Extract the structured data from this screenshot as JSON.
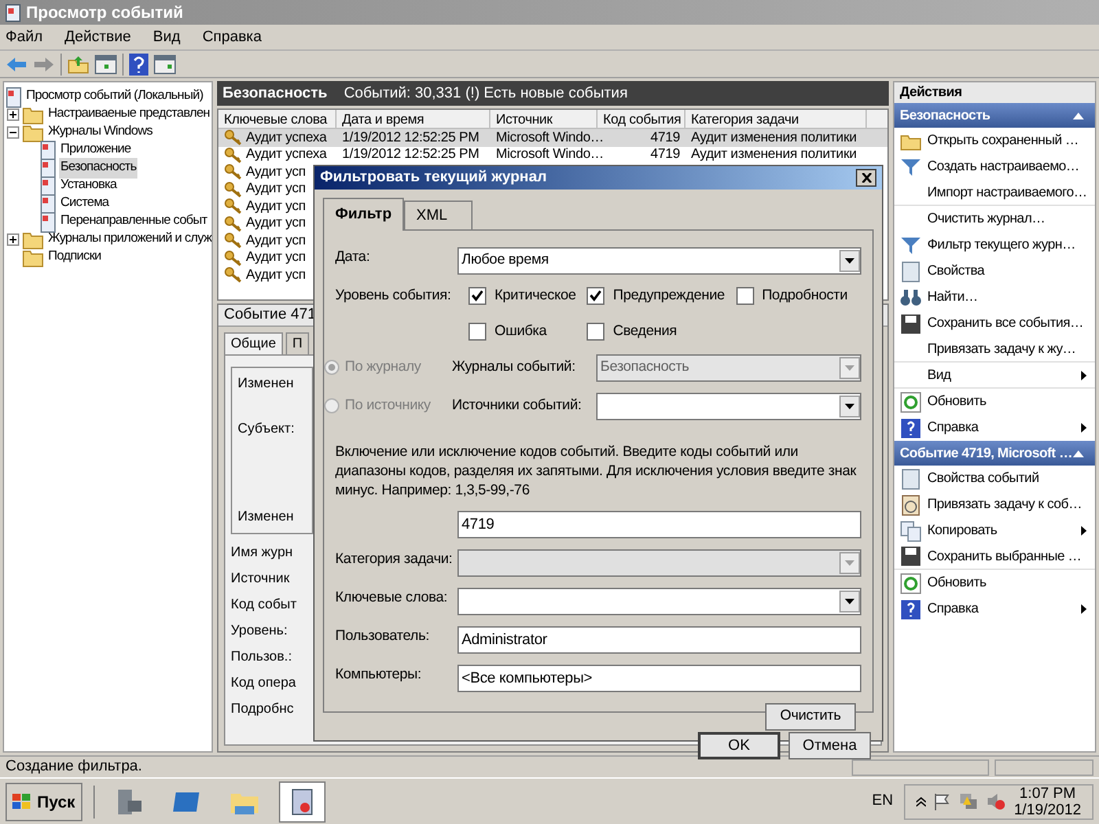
{
  "window": {
    "title": "Просмотр событий"
  },
  "menu": [
    "Файл",
    "Действие",
    "Вид",
    "Справка"
  ],
  "tree": [
    {
      "label": "Просмотр событий (Локальный)",
      "selected": false,
      "children": [
        {
          "label": "Настраиваеные представлен",
          "expanded": false,
          "selected": false
        },
        {
          "label": "Журналы Windows",
          "expanded": true,
          "selected": false,
          "children": [
            {
              "label": "Приложение",
              "selected": false
            },
            {
              "label": "Безопасность",
              "selected": true
            },
            {
              "label": "Установка",
              "selected": false
            },
            {
              "label": "Система",
              "selected": false
            },
            {
              "label": "Перенаправленные событ",
              "selected": false
            }
          ]
        },
        {
          "label": "Журналы приложений и служ",
          "expanded": false,
          "selected": false
        },
        {
          "label": "Подписки",
          "selected": false
        }
      ]
    }
  ],
  "log_header": {
    "title": "Безопасность",
    "info": "Событий: 30,331 (!) Есть новые события"
  },
  "table": {
    "columns": [
      "Ключевые слова",
      "Дата и время",
      "Источник",
      "Код события",
      "Категория задачи"
    ],
    "rows": [
      {
        "keywords": "Аудит успеха",
        "date": "1/19/2012 12:52:25 PM",
        "source": "Microsoft Windo…",
        "code": "4719",
        "category": "Аудит изменения политики",
        "selected": true
      },
      {
        "keywords": "Аудит успеха",
        "date": "1/19/2012 12:52:25 PM",
        "source": "Microsoft Windo…",
        "code": "4719",
        "category": "Аудит изменения политики",
        "selected": false
      },
      {
        "keywords": "Аудит усп",
        "selected": false
      },
      {
        "keywords": "Аудит усп",
        "selected": false
      },
      {
        "keywords": "Аудит усп",
        "selected": false
      },
      {
        "keywords": "Аудит усп",
        "selected": false
      },
      {
        "keywords": "Аудит усп",
        "selected": false
      },
      {
        "keywords": "Аудит усп",
        "selected": false
      },
      {
        "keywords": "Аудит усп",
        "selected": false
      }
    ]
  },
  "event_panel": {
    "title": "Событие 471",
    "tabs": [
      {
        "label": "Общие",
        "selected": true
      },
      {
        "label": "П",
        "selected": false
      }
    ],
    "box_lines": [
      "Изменен",
      "Субъект:",
      "Изменен"
    ],
    "fields": [
      "Имя журн",
      "Источник",
      "Код событ",
      "Уровень:",
      "Пользов.:",
      "Код опера",
      "Подробнс"
    ]
  },
  "actions": {
    "title": "Действия",
    "sections": [
      {
        "title": "Безопасность",
        "items": [
          {
            "label": "Открыть сохраненный …",
            "submenu": false
          },
          {
            "label": "Создать настраиваемо…",
            "submenu": false
          },
          {
            "label": "Импорт настраиваемого…",
            "submenu": false
          },
          {
            "label": "Очистить журнал…",
            "submenu": false
          },
          {
            "label": "Фильтр текущего журн…",
            "submenu": false
          },
          {
            "label": "Свойства",
            "submenu": false
          },
          {
            "label": "Найти…",
            "submenu": false
          },
          {
            "label": "Сохранить все события…",
            "submenu": false
          },
          {
            "label": "Привязать задачу к жу…",
            "submenu": false
          },
          {
            "label": "Вид",
            "submenu": true
          },
          {
            "label": "Обновить",
            "submenu": false
          },
          {
            "label": "Справка",
            "submenu": true
          }
        ]
      },
      {
        "title": "Событие 4719, Microsoft …",
        "items": [
          {
            "label": "Свойства событий",
            "submenu": false
          },
          {
            "label": "Привязать задачу к соб…",
            "submenu": false
          },
          {
            "label": "Копировать",
            "submenu": true
          },
          {
            "label": "Сохранить выбранные …",
            "submenu": false
          },
          {
            "label": "Обновить",
            "submenu": false
          },
          {
            "label": "Справка",
            "submenu": true
          }
        ]
      }
    ]
  },
  "status_bar": "Создание фильтра.",
  "dialog": {
    "title": "Фильтровать текущий журнал",
    "tabs": [
      {
        "label": "Фильтр",
        "selected": true
      },
      {
        "label": "XML",
        "selected": false
      }
    ],
    "date_label": "Дата:",
    "date_value": "Любое время",
    "level_label": "Уровень события:",
    "levels": [
      {
        "label": "Критическое",
        "checked": true
      },
      {
        "label": "Предупреждение",
        "checked": true
      },
      {
        "label": "Подробности",
        "checked": false
      },
      {
        "label": "Ошибка",
        "checked": false
      },
      {
        "label": "Сведения",
        "checked": false
      }
    ],
    "scope": [
      {
        "label": "По журналу",
        "selected": true,
        "disabled": true,
        "field_label": "Журналы событий:",
        "value": "Безопасность",
        "field_disabled": true
      },
      {
        "label": "По источнику",
        "selected": false,
        "disabled": true,
        "field_label": "Источники событий:",
        "field_disabled": false
      }
    ],
    "ids_hint": "Включение или исключение кодов событий. Введите коды событий или диапазоны кодов, разделяя их запятыми. Для исключения условия введите знак минус. Например: 1,3,5-99,-76",
    "ids_value": "4719",
    "fields": [
      {
        "kind": "select",
        "label": "Категория задачи:",
        "disabled": true
      },
      {
        "kind": "select",
        "label": "Ключевые слова:",
        "disabled": false
      },
      {
        "kind": "text",
        "label": "Пользователь:",
        "value": "Administrator"
      },
      {
        "kind": "text",
        "label": "Компьютеры:",
        "value": "<Все компьютеры>"
      }
    ],
    "clear_button": "Очистить",
    "ok_button": "OK",
    "cancel_button": "Отмена"
  },
  "taskbar": {
    "start": "Пуск",
    "apps": [
      {
        "selected": false
      },
      {
        "selected": false
      },
      {
        "selected": false
      },
      {
        "selected": true
      }
    ],
    "language": "EN",
    "time": "1:07 PM",
    "date": "1/19/2012"
  }
}
